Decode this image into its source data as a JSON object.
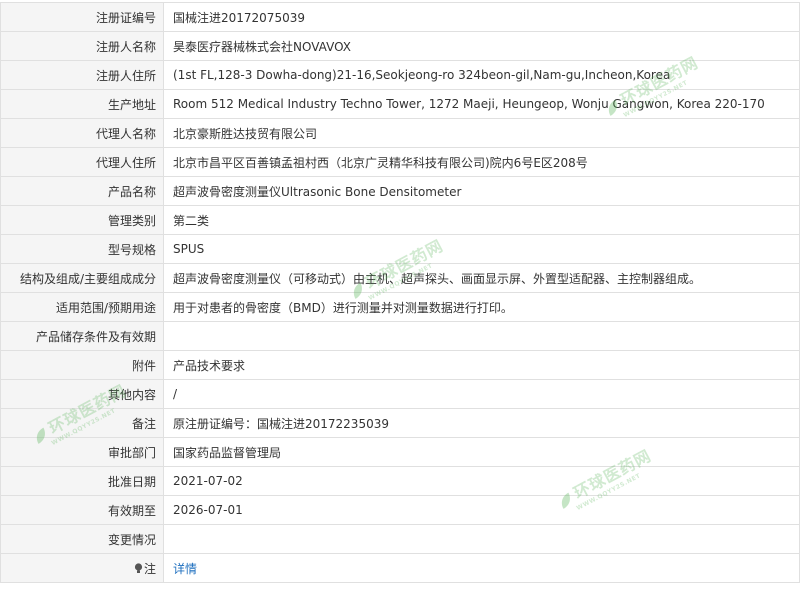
{
  "rows": [
    {
      "label": "注册证编号",
      "value": "国械注进20172075039"
    },
    {
      "label": "注册人名称",
      "value": "昊泰医疗器械株式会社NOVAVOX"
    },
    {
      "label": "注册人住所",
      "value": "(1st FL,128-3 Dowha-dong)21-16,Seokjeong-ro 324beon-gil,Nam-gu,Incheon,Korea"
    },
    {
      "label": "生产地址",
      "value": "Room 512 Medical Industry Techno Tower, 1272 Maeji, Heungeop, Wonju Gangwon, Korea 220-170"
    },
    {
      "label": "代理人名称",
      "value": "北京豪斯胜达技贸有限公司"
    },
    {
      "label": "代理人住所",
      "value": "北京市昌平区百善镇孟祖村西（北京广灵精华科技有限公司)院内6号E区208号"
    },
    {
      "label": "产品名称",
      "value": "超声波骨密度测量仪Ultrasonic Bone Densitometer"
    },
    {
      "label": "管理类别",
      "value": "第二类"
    },
    {
      "label": "型号规格",
      "value": "SPUS"
    },
    {
      "label": "结构及组成/主要组成成分",
      "value": "超声波骨密度测量仪（可移动式）由主机、超声探头、画面显示屏、外置型适配器、主控制器组成。"
    },
    {
      "label": "适用范围/预期用途",
      "value": "用于对患者的骨密度（BMD）进行测量并对测量数据进行打印。"
    },
    {
      "label": "产品储存条件及有效期",
      "value": ""
    },
    {
      "label": "附件",
      "value": "产品技术要求"
    },
    {
      "label": "其他内容",
      "value": "/"
    },
    {
      "label": "备注",
      "value": "原注册证编号：国械注进20172235039"
    },
    {
      "label": "审批部门",
      "value": "国家药品监督管理局"
    },
    {
      "label": "批准日期",
      "value": "2021-07-02"
    },
    {
      "label": "有效期至",
      "value": "2026-07-01"
    },
    {
      "label": "变更情况",
      "value": ""
    },
    {
      "label": "注",
      "value": "详情",
      "icon": "lightbulb-icon"
    }
  ],
  "watermark": {
    "main": "环球医药网",
    "sub": "WWW.QQYY2S.NET",
    "icon": "leaf-logo-icon"
  },
  "colors": {
    "label_bg": "#f5f5f5",
    "border": "#e0e0e0",
    "link": "#1e6fbf",
    "watermark": "#5ab45a"
  }
}
